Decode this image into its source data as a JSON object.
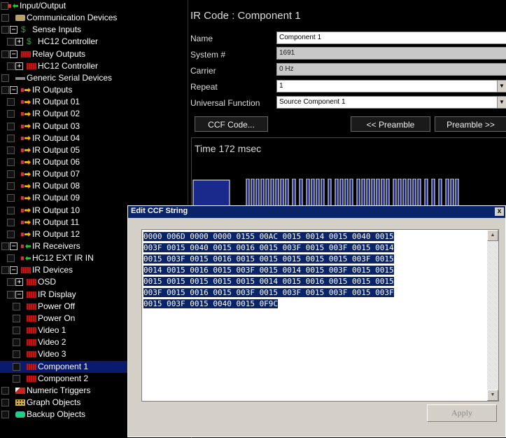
{
  "tree": {
    "items": [
      {
        "label": "Input/Output",
        "icon": "io-arrow-icon",
        "level": 0
      },
      {
        "label": "Communication Devices",
        "icon": "communication-devices-icon",
        "level": 1
      },
      {
        "label": "Sense Inputs",
        "icon": "dollar-icon",
        "level": 1,
        "expander": "−"
      },
      {
        "label": "HC12 Controller",
        "icon": "dollar-icon",
        "level": 2,
        "expander": "+"
      },
      {
        "label": "Relay Outputs",
        "icon": "relay-icon",
        "level": 1,
        "expander": "−"
      },
      {
        "label": "HC12 Controller",
        "icon": "relay-icon",
        "level": 2,
        "expander": "+"
      },
      {
        "label": "Generic Serial Devices",
        "icon": "serial-icon",
        "level": 1
      },
      {
        "label": "IR Outputs",
        "icon": "ir-output-icon",
        "level": 1,
        "expander": "−"
      },
      {
        "label": "IR Output 01",
        "icon": "ir-output-icon",
        "level": 2
      },
      {
        "label": "IR Output 02",
        "icon": "ir-output-icon",
        "level": 2
      },
      {
        "label": "IR Output 03",
        "icon": "ir-output-icon",
        "level": 2
      },
      {
        "label": "IR Output 04",
        "icon": "ir-output-icon",
        "level": 2
      },
      {
        "label": "IR Output 05",
        "icon": "ir-output-icon",
        "level": 2
      },
      {
        "label": "IR Output 06",
        "icon": "ir-output-icon",
        "level": 2
      },
      {
        "label": "IR Output 07",
        "icon": "ir-output-icon",
        "level": 2
      },
      {
        "label": "IR Output 08",
        "icon": "ir-output-icon",
        "level": 2
      },
      {
        "label": "IR Output 09",
        "icon": "ir-output-icon",
        "level": 2
      },
      {
        "label": "IR Output 10",
        "icon": "ir-output-icon",
        "level": 2
      },
      {
        "label": "IR Output 11",
        "icon": "ir-output-icon",
        "level": 2
      },
      {
        "label": "IR Output 12",
        "icon": "ir-output-icon",
        "level": 2
      },
      {
        "label": "IR Receivers",
        "icon": "ir-receiver-icon",
        "level": 1,
        "expander": "−"
      },
      {
        "label": "HC12 EXT IR IN",
        "icon": "ir-receiver-icon",
        "level": 2
      },
      {
        "label": "IR Devices",
        "icon": "ir-device-icon",
        "level": 1,
        "expander": "−"
      },
      {
        "label": "OSD",
        "icon": "ir-device-icon",
        "level": 2,
        "expander": "+"
      },
      {
        "label": "IR Display",
        "icon": "ir-device-icon",
        "level": 2,
        "expander": "−"
      },
      {
        "label": "Power Off",
        "icon": "ir-code-icon",
        "level": 3
      },
      {
        "label": "Power On",
        "icon": "ir-code-icon",
        "level": 3
      },
      {
        "label": "Video 1",
        "icon": "ir-code-icon",
        "level": 3
      },
      {
        "label": "Video 2",
        "icon": "ir-code-icon",
        "level": 3
      },
      {
        "label": "Video 3",
        "icon": "ir-code-icon",
        "level": 3
      },
      {
        "label": "Component 1",
        "icon": "ir-code-icon",
        "level": 3,
        "selected": true
      },
      {
        "label": "Component 2",
        "icon": "ir-code-icon",
        "level": 3
      },
      {
        "label": "Numeric Triggers",
        "icon": "numeric-triggers-icon",
        "level": 1
      },
      {
        "label": "Graph Objects",
        "icon": "graph-objects-icon",
        "level": 1
      },
      {
        "label": "Backup Objects",
        "icon": "backup-objects-icon",
        "level": 1
      }
    ]
  },
  "panel": {
    "title": "IR Code : Component 1",
    "fields": {
      "name_label": "Name",
      "name_value": "Component 1",
      "system_label": "System #",
      "system_value": "1691",
      "carrier_label": "Carrier",
      "carrier_value": "0 Hz",
      "repeat_label": "Repeat",
      "repeat_value": "1",
      "universal_label": "Universal Function",
      "universal_value": "Source Component 1"
    },
    "buttons": {
      "ccf": "CCF Code...",
      "prev_preamble": "<< Preamble",
      "next_preamble": "Preamble >>"
    },
    "time_label": "Time 172 msec"
  },
  "dialog": {
    "title": "Edit CCF String",
    "close": "x",
    "ccf_lines": [
      "0000 006D 0000 0000 0155 00AC 0015 0014 0015 0040 0015",
      "003F 0015 0040 0015 0016 0015 003F 0015 003F 0015 0014",
      "0015 003F 0015 0016 0015 0015 0015 0015 0015 003F 0015",
      "0014 0015 0016 0015 003F 0015 0014 0015 003F 0015 0015",
      "0015 0015 0015 0015 0015 0014 0015 0016 0015 0015 0015",
      "003F 0015 0016 0015 003F 0015 003F 0015 003F 0015 003F",
      "0015 003F 0015 0040 0015 0F9C"
    ],
    "apply": "Apply"
  },
  "colors": {
    "selection": "#0a246a",
    "tree_selected": "#0a1a6e",
    "wave": "#1a2a8c"
  }
}
